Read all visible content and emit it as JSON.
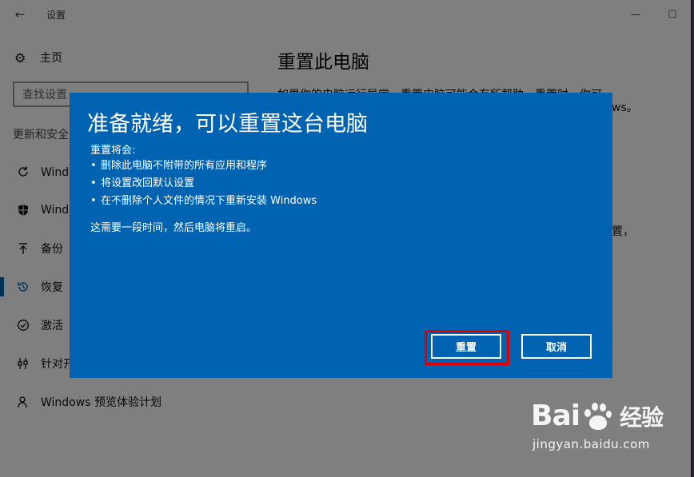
{
  "window": {
    "title": "设置",
    "back_icon": "arrow-left-icon",
    "minimize_glyph": "—",
    "maximize_glyph": "☐"
  },
  "sidebar": {
    "home_label": "主页",
    "search_placeholder": "查找设置",
    "section_label": "更新和安全",
    "items": [
      {
        "label": "Windows 更新",
        "icon": "refresh-icon"
      },
      {
        "label": "Windows Defender",
        "icon": "shield-icon"
      },
      {
        "label": "备份",
        "icon": "backup-arrow-icon"
      },
      {
        "label": "恢复",
        "icon": "history-icon",
        "active": true
      },
      {
        "label": "激活",
        "icon": "check-circle-icon"
      },
      {
        "label": "针对开发人员",
        "icon": "developer-tools-icon"
      },
      {
        "label": "Windows 预览体验计划",
        "icon": "person-icon"
      }
    ]
  },
  "content": {
    "title": "重置此电脑",
    "para1": "如果你的电脑运行异常，重置电脑可能会有所帮助。重置时，你可",
    "frag1": "ws。",
    "frag2": "置，"
  },
  "dialog": {
    "title": "准备就绪，可以重置这台电脑",
    "intro": "重置将会:",
    "bullets": [
      "删除此电脑不附带的所有应用和程序",
      "将设置改回默认设置",
      "在不删除个人文件的情况下重新安装 Windows"
    ],
    "note": "这需要一段时间，然后电脑将重启。",
    "reset_label": "重置",
    "cancel_label": "取消"
  },
  "colors": {
    "accent": "#0063b1",
    "highlight": "#e00000"
  },
  "watermark": {
    "logo_prefix": "Bai",
    "logo_suffix": "经验",
    "url": "jingyan.baidu.com"
  }
}
